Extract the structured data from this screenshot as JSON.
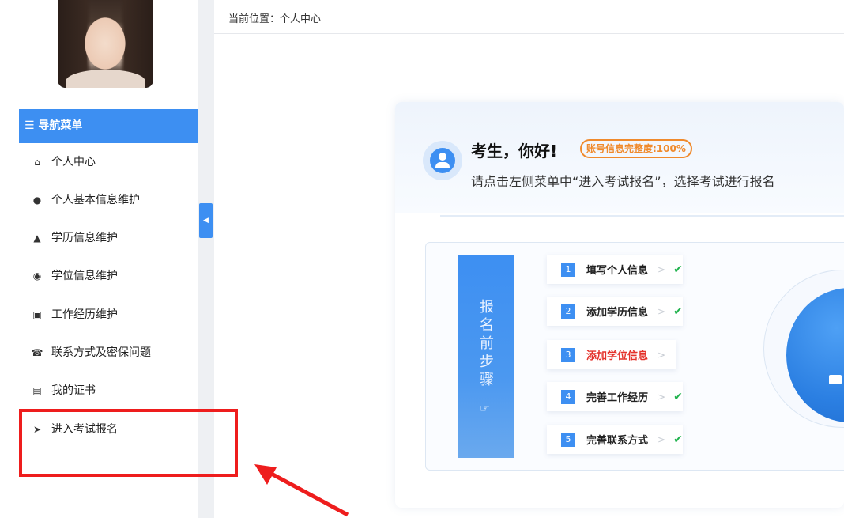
{
  "breadcrumb": "当前位置：个人中心",
  "sidebar": {
    "menu_title": "☰ 导航菜单",
    "items": [
      {
        "label": "个人中心",
        "icon": "home-icon"
      },
      {
        "label": "个人基本信息维护",
        "icon": "user-icon"
      },
      {
        "label": "学历信息维护",
        "icon": "graduation-cap-icon"
      },
      {
        "label": "学位信息维护",
        "icon": "medal-icon"
      },
      {
        "label": "工作经历维护",
        "icon": "briefcase-icon"
      },
      {
        "label": "联系方式及密保问题",
        "icon": "phone-icon"
      },
      {
        "label": "我的证书",
        "icon": "certificate-icon"
      },
      {
        "label": "进入考试报名",
        "icon": "arrow-circle-icon"
      }
    ]
  },
  "welcome": {
    "greeting": "考生，你好!",
    "badge": "账号信息完整度:100%",
    "hint": "请点击左侧菜单中“进入考试报名”，选择考试进行报名"
  },
  "steps": {
    "banner": "报名前步骤",
    "items": [
      {
        "num": "1",
        "label": "填写个人信息",
        "done": "✔"
      },
      {
        "num": "2",
        "label": "添加学历信息",
        "done": "✔"
      },
      {
        "num": "3",
        "label": "添加学位信息",
        "done": ""
      },
      {
        "num": "4",
        "label": "完善工作经历",
        "done": "✔"
      },
      {
        "num": "5",
        "label": "完善联系方式",
        "done": "✔"
      }
    ],
    "arrow": ">"
  },
  "colors": {
    "accent": "#3d8ff2",
    "highlight": "#ee1d1d",
    "badge": "#f08a2c",
    "check": "#1fb24c",
    "pending": "#e4322b"
  }
}
